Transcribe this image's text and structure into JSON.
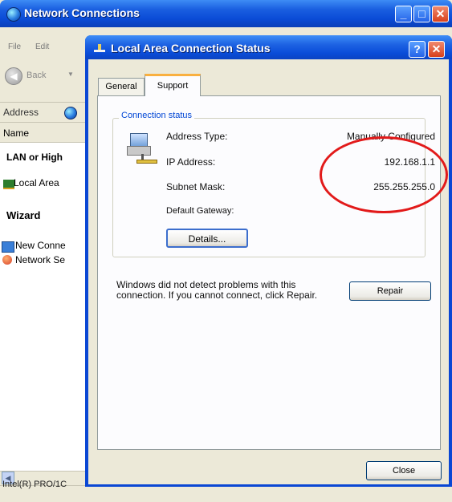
{
  "bg_window": {
    "title": "Network Connections",
    "menu": [
      "File",
      "Edit"
    ],
    "toolbar_back": "Back",
    "address_label": "Address",
    "column_name": "Name",
    "group_lan": "LAN or High",
    "item_local_area": "Local Area",
    "group_wizard": "Wizard",
    "item_new_connection": "New Conne",
    "item_network_setup": "Network Se",
    "status_text": "Intel(R) PRO/1C"
  },
  "dialog": {
    "title": "Local Area Connection Status",
    "help_glyph": "?",
    "tabs": [
      "General",
      "Support"
    ],
    "group_title": "Connection status",
    "address_type_label": "Address Type:",
    "address_type_value": "Manually Configured",
    "ip_label": "IP Address:",
    "ip_value": "192.168.1.1",
    "subnet_label": "Subnet Mask:",
    "subnet_value": "255.255.255.0",
    "gateway_label": "Default Gateway:",
    "details_button": "Details...",
    "message": "Windows did not detect problems with this connection. If you cannot connect, click Repair.",
    "repair_button": "Repair",
    "close_button": "Close"
  },
  "colors": {
    "xp_title_blue": "#0a4bd6",
    "dialog_face": "#ece9d8",
    "group_title_blue": "#0046d5",
    "highlight_circle": "#e21a1a"
  }
}
